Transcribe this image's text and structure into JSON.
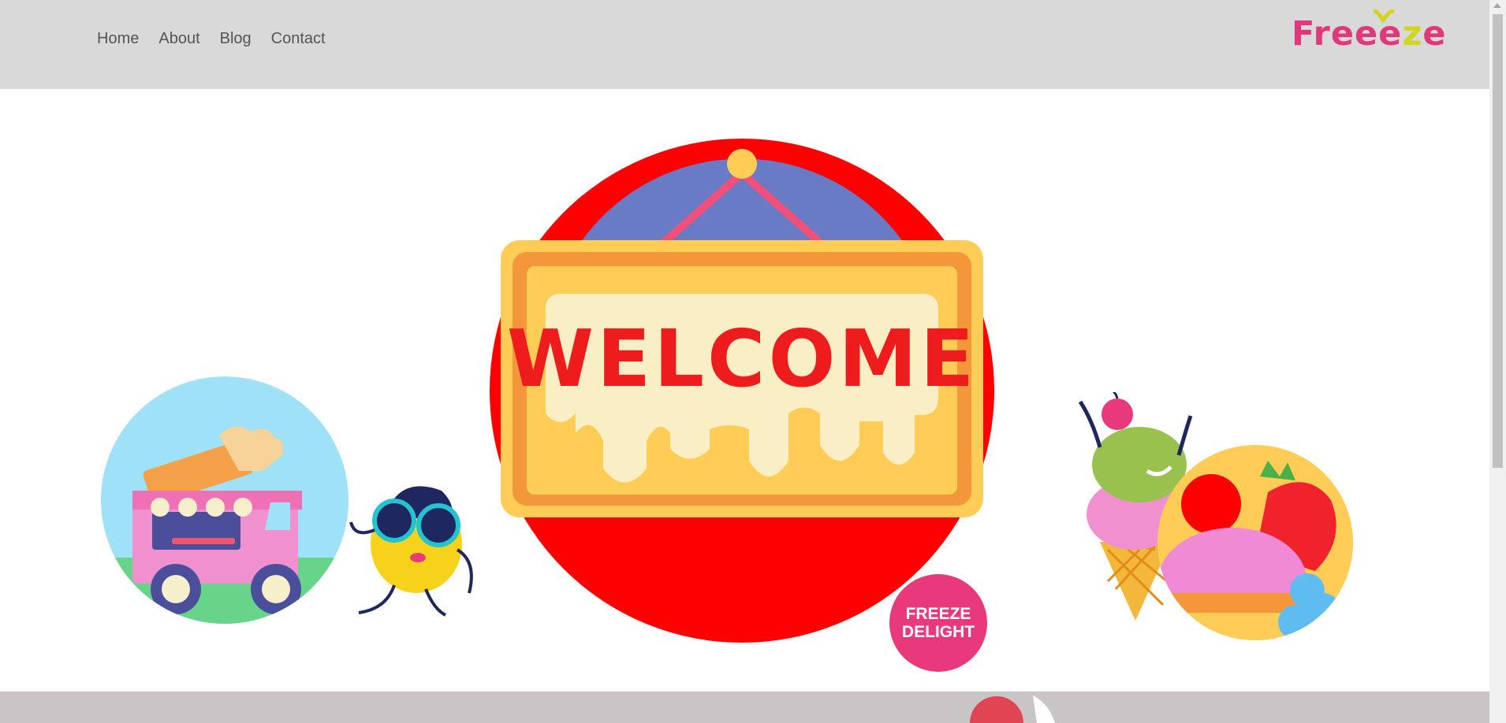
{
  "nav": {
    "links": [
      {
        "label": "Home"
      },
      {
        "label": "About"
      },
      {
        "label": "Blog"
      },
      {
        "label": "Contact"
      }
    ]
  },
  "logo": {
    "text_part1": "Freee",
    "text_part2": "z",
    "text_part3": "e",
    "colors": {
      "primary": "#e0397b",
      "accent": "#cfd61c"
    }
  },
  "hero": {
    "sign_text": "WELCOME",
    "badge_line1": "FREEZE",
    "badge_line2": "DELIGHT",
    "colors": {
      "main_circle": "#ff0000",
      "sign_frame": "#f4973a",
      "sign_board": "#ffcc55",
      "sign_text": "#ee1c1c",
      "drip": "#f9eec4",
      "badge": "#e8397d",
      "sky": "#6a7bc6"
    }
  },
  "colors": {
    "nav_bg": "#d9d9d9",
    "nav_text": "#555555",
    "footer_bg": "#c9c4c5"
  }
}
